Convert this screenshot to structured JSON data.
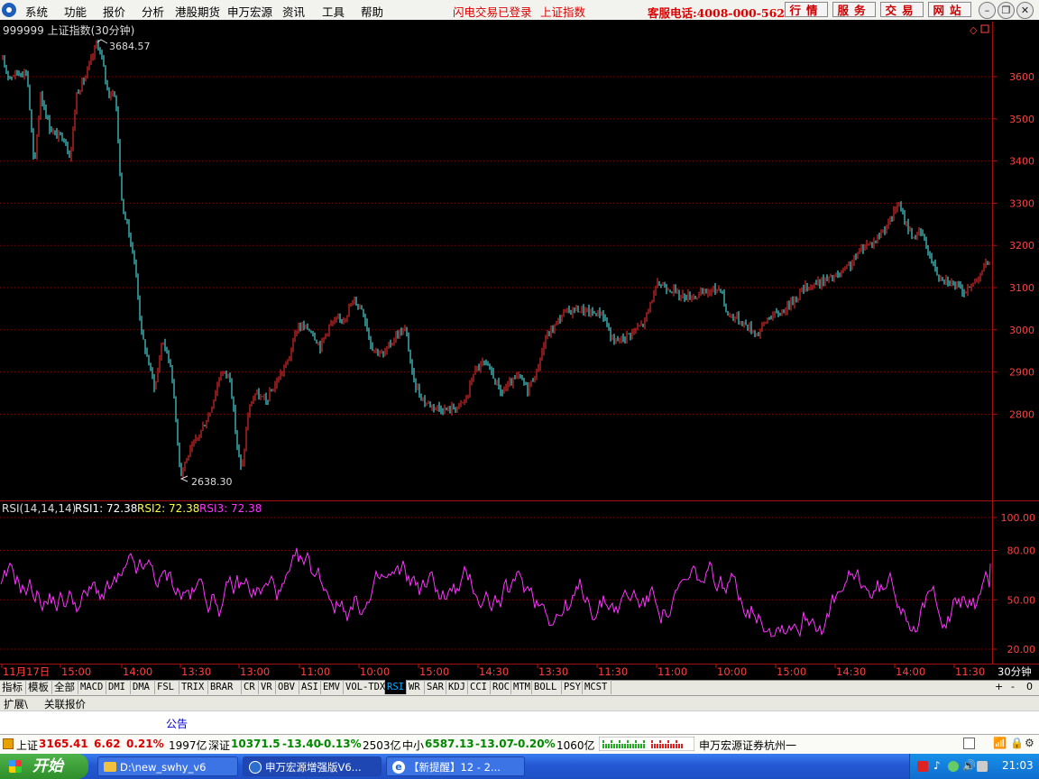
{
  "menu": [
    "系统",
    "功能",
    "报价",
    "分析",
    "港股期货",
    "申万宏源",
    "资讯",
    "工具",
    "帮助"
  ],
  "status": {
    "flash_login": "闪电交易已登录",
    "index_name": "上证指数"
  },
  "hotline": "客服电话:4008-000-562",
  "quick_buttons": [
    "行情",
    "服务",
    "交易",
    "网站"
  ],
  "chart": {
    "title": "999999 上证指数(30分钟)",
    "high_label": "3684.57",
    "low_label": "2638.30",
    "price_ticks": [
      "3600",
      "3500",
      "3400",
      "3300",
      "3200",
      "3100",
      "3000",
      "2900",
      "2800"
    ],
    "rsi_label": "RSI(14,14,14)",
    "rsi1": "RSI1: 72.38",
    "rsi2": "RSI2: 72.38",
    "rsi3": "RSI3: 72.38",
    "rsi_ticks": [
      "100.00",
      "80.00",
      "50.00",
      "20.00"
    ],
    "time_labels": [
      "11月17日",
      "15:00",
      "14:00",
      "13:30",
      "13:00",
      "11:00",
      "10:00",
      "15:00",
      "14:30",
      "13:30",
      "11:30",
      "11:00",
      "10:00",
      "15:00",
      "14:30",
      "14:00",
      "11:30"
    ],
    "period": "30分钟",
    "colors": {
      "up": "#ff3333",
      "down": "#54ffff",
      "rsi": "#ff33ff",
      "rsi2": "#ffff44",
      "grid": "#8b0000"
    }
  },
  "tabs": [
    "指标",
    "模板",
    "全部",
    "MACD",
    "DMI",
    "DMA",
    "FSL",
    "TRIX",
    "BRAR",
    "CR",
    "VR",
    "OBV",
    "ASI",
    "EMV",
    "VOL-TDX",
    "RSI",
    "WR",
    "SAR",
    "KDJ",
    "CCI",
    "ROC",
    "MTM",
    "BOLL",
    "PSY",
    "MCST"
  ],
  "active_tab": "RSI",
  "tab_controls": [
    "+",
    "-",
    "0"
  ],
  "subtabs": [
    "扩展\\",
    "关联报价"
  ],
  "notice": "公告",
  "ticker": {
    "sh_name": "上证",
    "sh_price": "3165.41",
    "sh_change": "6.62",
    "sh_pct": "0.21%",
    "sh_amount": "1997亿",
    "sz_name": "深证",
    "sz_price": "10371.5",
    "sz_change": "-13.40",
    "sz_pct": "-0.13%",
    "sz_amount": "2503亿",
    "zx_name": "中小",
    "zx_price": "6587.13",
    "zx_change": "-13.07",
    "zx_pct": "-0.20%",
    "zx_amount": "1060亿",
    "broker": "申万宏源证券杭州一"
  },
  "taskbar": {
    "start": "开始",
    "tasks": [
      "D:\\new_swhy_v6",
      "申万宏源增强版V6...",
      "【新提醒】12 - 2..."
    ],
    "clock": "21:03"
  }
}
